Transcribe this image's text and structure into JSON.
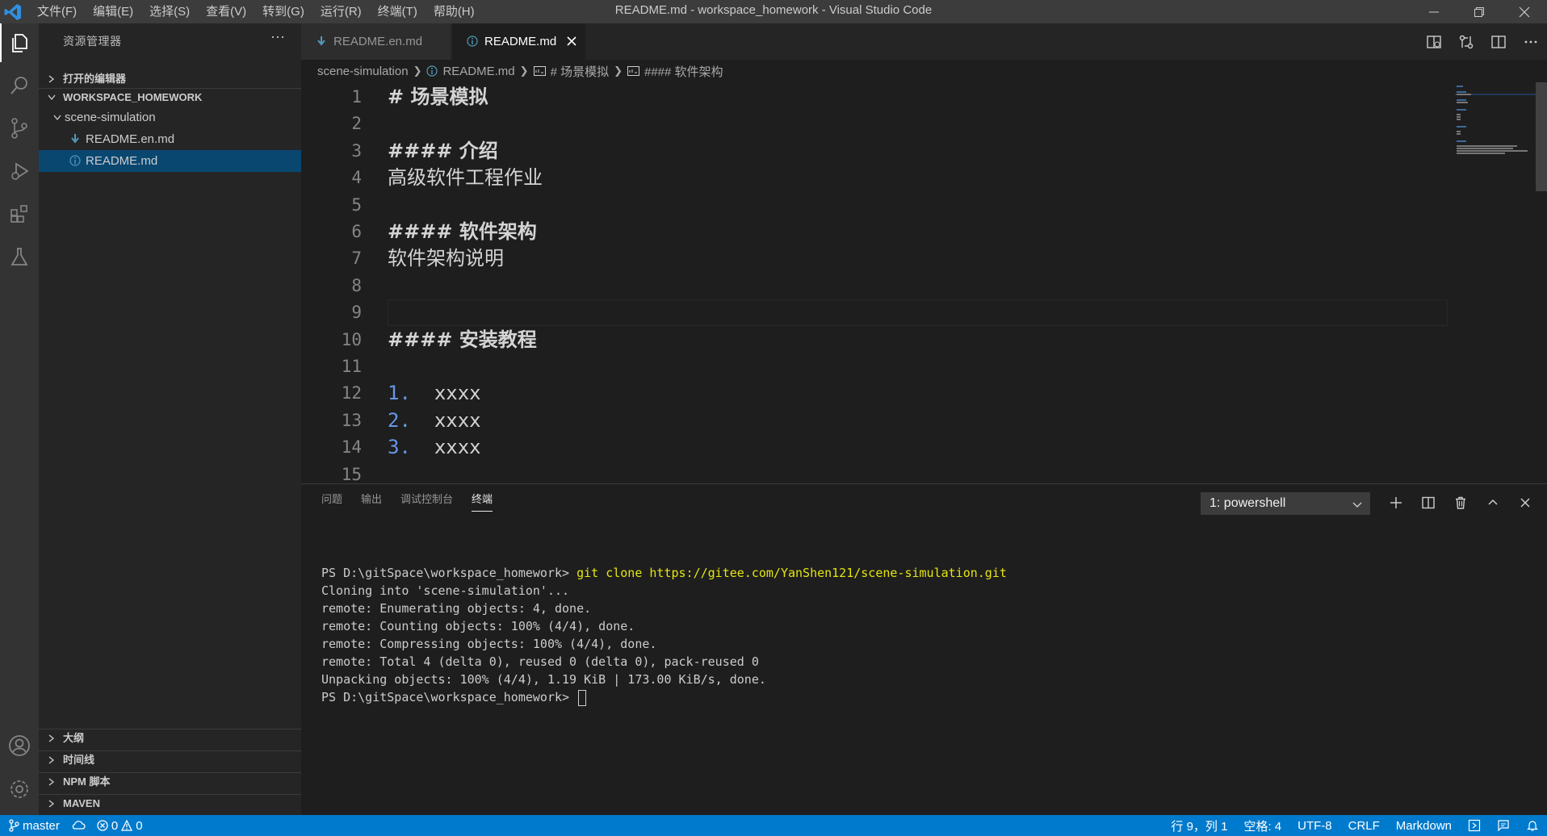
{
  "titlebar": {
    "menu": [
      "文件(F)",
      "编辑(E)",
      "选择(S)",
      "查看(V)",
      "转到(G)",
      "运行(R)",
      "终端(T)",
      "帮助(H)"
    ],
    "window_title": "README.md - workspace_homework - Visual Studio Code"
  },
  "sidebar": {
    "title": "资源管理器",
    "more": "···",
    "open_editors": "打开的编辑器",
    "workspace": "WORKSPACE_HOMEWORK",
    "folder": "scene-simulation",
    "files": [
      "README.en.md",
      "README.md"
    ],
    "bottom_sections": [
      "大纲",
      "时间线",
      "NPM 脚本",
      "MAVEN"
    ]
  },
  "tabs": [
    {
      "label": "README.en.md",
      "active": false
    },
    {
      "label": "README.md",
      "active": true
    }
  ],
  "breadcrumb": {
    "folder": "scene-simulation",
    "file": "README.md",
    "h1": "# 场景模拟",
    "h4": "#### 软件架构"
  },
  "editor": {
    "lines": [
      {
        "n": "1",
        "type": "h",
        "mark": "#",
        "text": "场景模拟"
      },
      {
        "n": "2",
        "type": "empty"
      },
      {
        "n": "3",
        "type": "h",
        "mark": "####",
        "text": "介绍"
      },
      {
        "n": "4",
        "type": "text",
        "text": "高级软件工程作业"
      },
      {
        "n": "5",
        "type": "empty"
      },
      {
        "n": "6",
        "type": "h",
        "mark": "####",
        "text": "软件架构"
      },
      {
        "n": "7",
        "type": "text",
        "text": "软件架构说明"
      },
      {
        "n": "8",
        "type": "empty"
      },
      {
        "n": "9",
        "type": "empty"
      },
      {
        "n": "10",
        "type": "h",
        "mark": "####",
        "text": "安装教程"
      },
      {
        "n": "11",
        "type": "empty"
      },
      {
        "n": "12",
        "type": "li",
        "mark": "1.",
        "text": "xxxx"
      },
      {
        "n": "13",
        "type": "li",
        "mark": "2.",
        "text": "xxxx"
      },
      {
        "n": "14",
        "type": "li",
        "mark": "3.",
        "text": "xxxx"
      },
      {
        "n": "15",
        "type": "empty"
      }
    ]
  },
  "panel": {
    "tabs": [
      "问题",
      "输出",
      "调试控制台",
      "终端"
    ],
    "active_tab": "终端",
    "terminal_select": "1: powershell",
    "terminal": {
      "prompt": "PS D:\\gitSpace\\workspace_homework> ",
      "command": "git clone https://gitee.com/YanShen121/scene-simulation.git",
      "output": [
        "Cloning into 'scene-simulation'...",
        "remote: Enumerating objects: 4, done.",
        "remote: Counting objects: 100% (4/4), done.",
        "remote: Compressing objects: 100% (4/4), done.",
        "remote: Total 4 (delta 0), reused 0 (delta 0), pack-reused 0",
        "Unpacking objects: 100% (4/4), 1.19 KiB | 173.00 KiB/s, done."
      ],
      "final_prompt": "PS D:\\gitSpace\\workspace_homework> "
    }
  },
  "statusbar": {
    "branch": "master",
    "errors": "0",
    "warnings": "0",
    "position": "行 9，列 1",
    "spaces": "空格: 4",
    "encoding": "UTF-8",
    "eol": "CRLF",
    "language": "Markdown"
  },
  "colors": {
    "accent": "#007acc",
    "selection": "#094771",
    "heading": "#569cd6"
  }
}
